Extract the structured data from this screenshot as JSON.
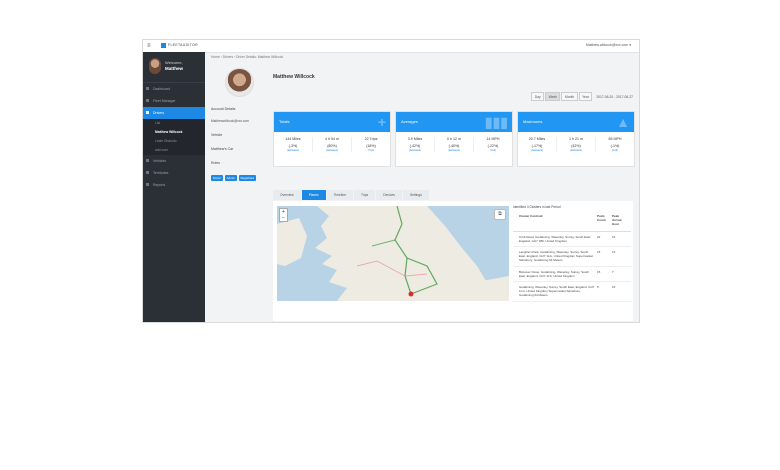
{
  "topbar": {
    "brand": "FLEETAUDITOR",
    "user": "Matthew.willcock@xxx.com ▾"
  },
  "sidebar": {
    "welcome": "Welcome,",
    "name": "Matthew",
    "items": [
      {
        "label": "Dashboard"
      },
      {
        "label": "Fleet Manager"
      },
      {
        "label": "Drivers"
      }
    ],
    "sub_items": [
      {
        "label": "List"
      },
      {
        "label": "Matthew Willcock"
      },
      {
        "label": "Linde Ghanoto"
      },
      {
        "label": "add user"
      }
    ],
    "items2": [
      {
        "label": "Vehicles"
      },
      {
        "label": "Territories"
      },
      {
        "label": "Reports"
      }
    ]
  },
  "breadcrumb": "Home  ›  Drivers  ›  Driver Details: Matthew Willcock",
  "profile": {
    "name": "Matthew Willcock",
    "account_details": "Account Details",
    "email": "Matthewwillcock@xxx.com",
    "vehicle_label": "Vehicle",
    "vehicle": "Matthew's Car",
    "roles_label": "Roles",
    "roles": [
      "Driver",
      "Admin",
      "Registrars"
    ]
  },
  "periods": {
    "buttons": [
      "Day",
      "Week",
      "Month",
      "Year"
    ],
    "selected": "Week",
    "range": "2017-06-20 - 2017-06-27"
  },
  "cards": [
    {
      "title": "Totals",
      "cols": [
        {
          "v1": "144 Miles",
          "v2": "(-3%)",
          "v3": "(lastweek)"
        },
        {
          "v1": "4 h 54 m",
          "v2": "(80%)",
          "v3": "(lastweek)"
        },
        {
          "v1": "22 Trips",
          "v2": "(18%)",
          "v3": "Trips"
        }
      ]
    },
    {
      "title": "Averages",
      "cols": [
        {
          "v1": "3.9 Miles",
          "v2": "(-42%)",
          "v3": "(lastweek)"
        },
        {
          "v1": "0 h 12 m",
          "v2": "(-40%)",
          "v3": "(lastweek)"
        },
        {
          "v1": "14 MPH",
          "v2": "(-22%)",
          "v3": "(mtd)"
        }
      ]
    },
    {
      "title": "Maximums",
      "cols": [
        {
          "v1": "20.7 Miles",
          "v2": "(-17%)",
          "v3": "(lastweek)"
        },
        {
          "v1": "1 h 21 m",
          "v2": "(42%)",
          "v3": "(lastweek)"
        },
        {
          "v1": "65 MPH",
          "v2": "(-1%)",
          "v3": "(mtd)"
        }
      ]
    }
  ],
  "tabs": [
    "Overview",
    "Places",
    "Timeline",
    "Trips",
    "Devices",
    "Settings"
  ],
  "selected_tab": "Places",
  "map": {
    "zoom_in": "+",
    "zoom_out": "−"
  },
  "places_table": {
    "title": "Identified 4 Clusters in last Period",
    "headers": [
      "Cluster Centroid",
      "Point Count",
      "Peak Arrival Hour"
    ],
    "rows": [
      {
        "centroid": "Croft Road, Godalming, Waverley, Surrey, South East, England, GU7 1BF, United Kingdom",
        "count": "22",
        "hour": "16"
      },
      {
        "centroid": "Langham Park, Godalming, Waverley, Surrey, South East, England, GU7 1LG, United Kingdom Supermarket Sainsbury, Godalming 64 Meters",
        "count": "15",
        "hour": "15"
      },
      {
        "centroid": "Bolsover Close, Godalming, Waverley, Surrey, South East, England, GU7 1LS, United Kingdom",
        "count": "15",
        "hour": "7"
      },
      {
        "centroid": "Godalming, Waverley, Surrey, South East, England, GU7 1LG, United Kingdom Supermarket Sainsbury, Godalming 64 Meters",
        "count": "5",
        "hour": "16"
      }
    ]
  }
}
